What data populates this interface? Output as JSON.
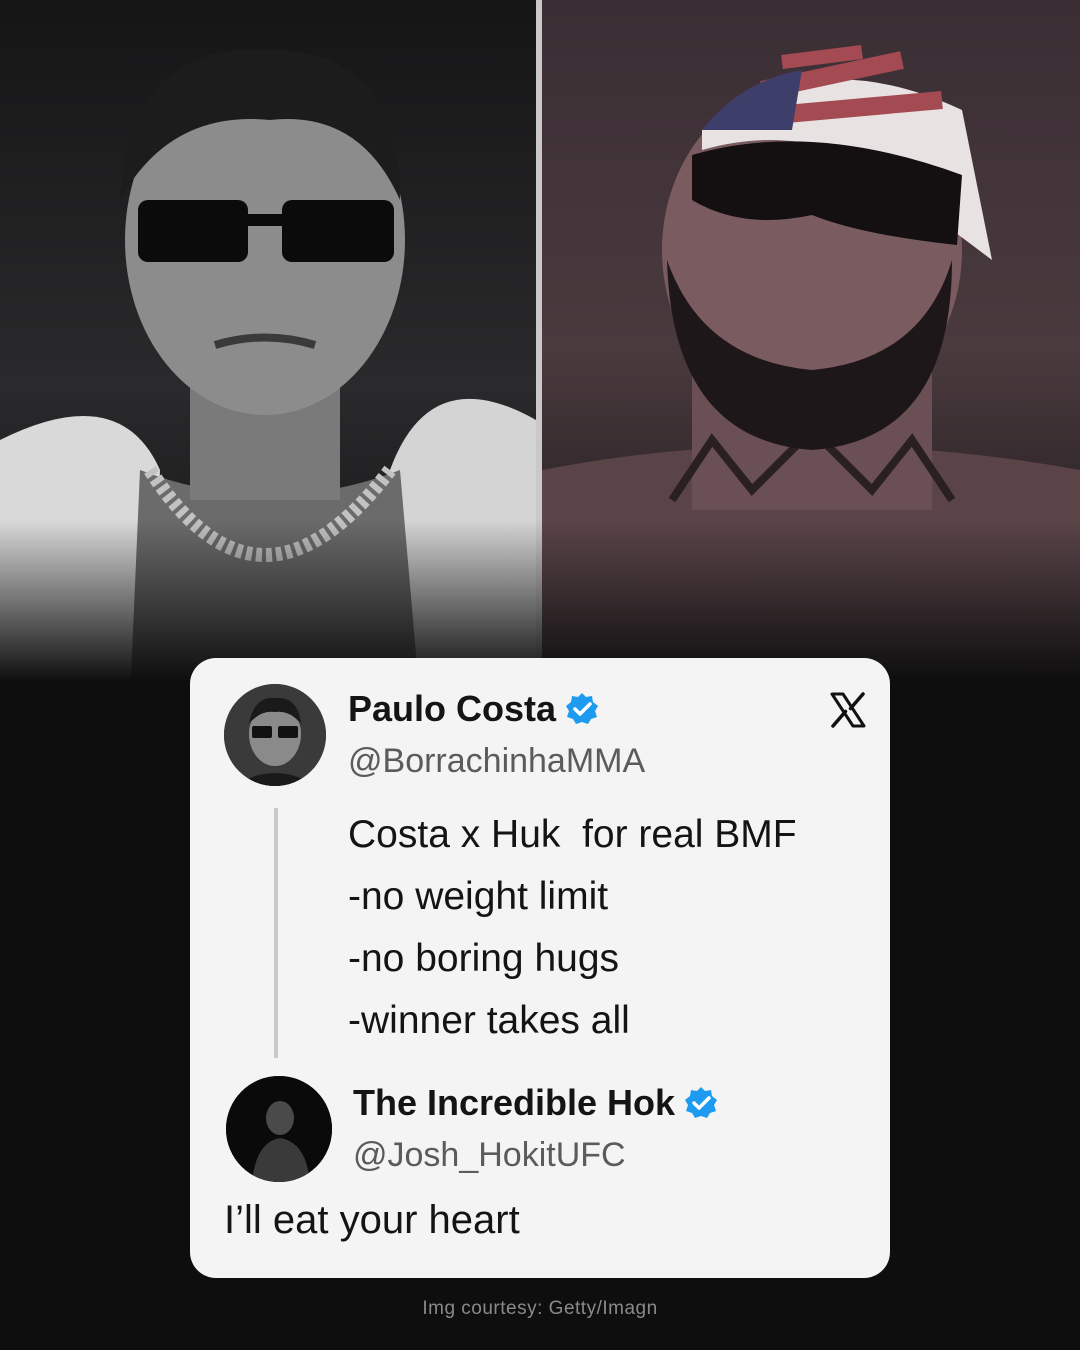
{
  "photos": {
    "left": {
      "icon": "fighter-portrait-sunglasses"
    },
    "right": {
      "icon": "fighter-portrait-flag-bandana"
    }
  },
  "tweet": {
    "author_name": "Paulo Costa",
    "author_handle": "@BorrachinhaMMA",
    "lines": [
      "Costa x Huk  for real BMF",
      "-no weight limit",
      "-no boring hugs",
      "-winner takes all"
    ],
    "platform_icon": "x-logo-icon"
  },
  "reply": {
    "author_name": "The Incredible Hok",
    "author_handle": "@Josh_HokitUFC",
    "text": "I’ll eat your heart"
  },
  "footer": {
    "credit": "Img courtesy: Getty/Imagn"
  },
  "colors": {
    "verified": "#1d9bf0",
    "card_bg": "#f4f4f4",
    "page_bg": "#0e0e0f"
  }
}
